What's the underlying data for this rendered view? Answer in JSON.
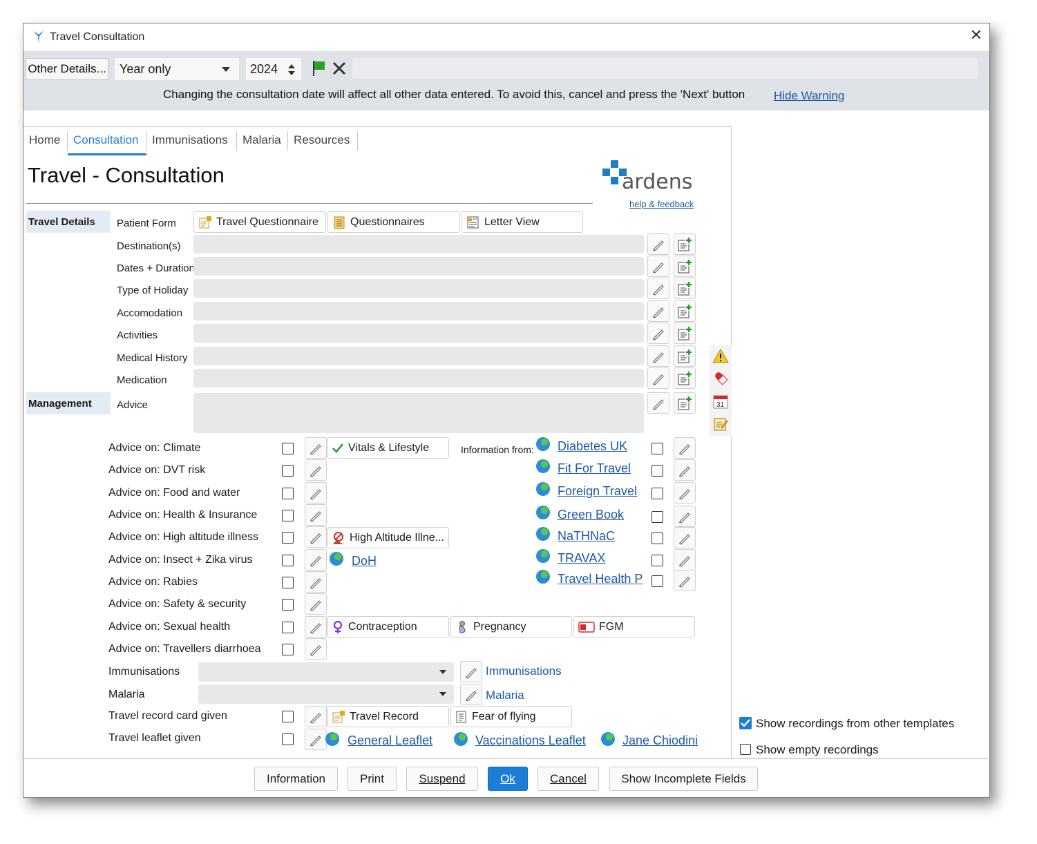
{
  "window": {
    "title": "Travel Consultation",
    "close": "✕"
  },
  "toolbar": {
    "other_details": "Other Details...",
    "date_mode": "Year only",
    "year": "2024",
    "warning": "Changing the consultation date will affect all other data entered. To avoid this, cancel and press the 'Next' button",
    "hide_warning": "Hide Warning"
  },
  "tabs": [
    "Home",
    "Consultation",
    "Immunisations",
    "Malaria",
    "Resources"
  ],
  "page_title": "Travel - Consultation",
  "logo": {
    "text": "ardens",
    "help": "help & feedback"
  },
  "travel_details": {
    "header": "Travel Details",
    "patient_form_label": "Patient Form",
    "buttons": [
      "Travel Questionnaire",
      "Questionnaires",
      "Letter View"
    ],
    "fields": [
      "Destination(s)",
      "Dates + Duration",
      "Type of Holiday",
      "Accomodation",
      "Activities",
      "Medical History",
      "Medication"
    ]
  },
  "management": {
    "header": "Management",
    "advice_label": "Advice"
  },
  "advice_items": [
    "Advice on: Climate",
    "Advice on: DVT risk",
    "Advice on: Food and water",
    "Advice on: Health & Insurance",
    "Advice on: High altitude illness",
    "Advice on: Insect + Zika virus",
    "Advice on: Rabies",
    "Advice on: Safety & security",
    "Advice on: Sexual health",
    "Advice on: Travellers diarrhoea"
  ],
  "advice_buttons": {
    "vitals": "Vitals & Lifestyle",
    "high_altitude": "High Altitude Illne...",
    "doh": "DoH",
    "contraception": "Contraception",
    "pregnancy": "Pregnancy",
    "fgm": "FGM"
  },
  "information": {
    "label": "Information from:",
    "links": [
      "Diabetes UK",
      "Fit For Travel",
      "Foreign Travel",
      "Green Book",
      "NaTHNaC",
      "TRAVAX",
      "Travel Health P"
    ]
  },
  "lower": {
    "immunisations_label": "Immunisations",
    "immunisations_link": "Immunisations",
    "malaria_label": "Malaria",
    "malaria_link": "Malaria",
    "record_card_label": "Travel record card given",
    "leaflet_label": "Travel leaflet given",
    "travel_record": "Travel Record",
    "fear_of_flying": "Fear of flying",
    "general_leaflet": "General Leaflet",
    "vaccinations_leaflet": "Vaccinations Leaflet",
    "jane_chiodini": "Jane Chiodini"
  },
  "options": {
    "show_other": "Show recordings from other templates",
    "show_other_checked": true,
    "show_empty": "Show empty recordings",
    "show_empty_checked": false
  },
  "bottom_buttons": {
    "information": "Information",
    "print": "Print",
    "suspend": "Suspend",
    "ok": "Ok",
    "cancel": "Cancel",
    "incomplete": "Show Incomplete Fields"
  },
  "colors": {
    "accent": "#1c7ed6",
    "link": "#1c5aa6",
    "warning_bar": "#dfe2e6",
    "section_header": "#e3ebf5"
  }
}
